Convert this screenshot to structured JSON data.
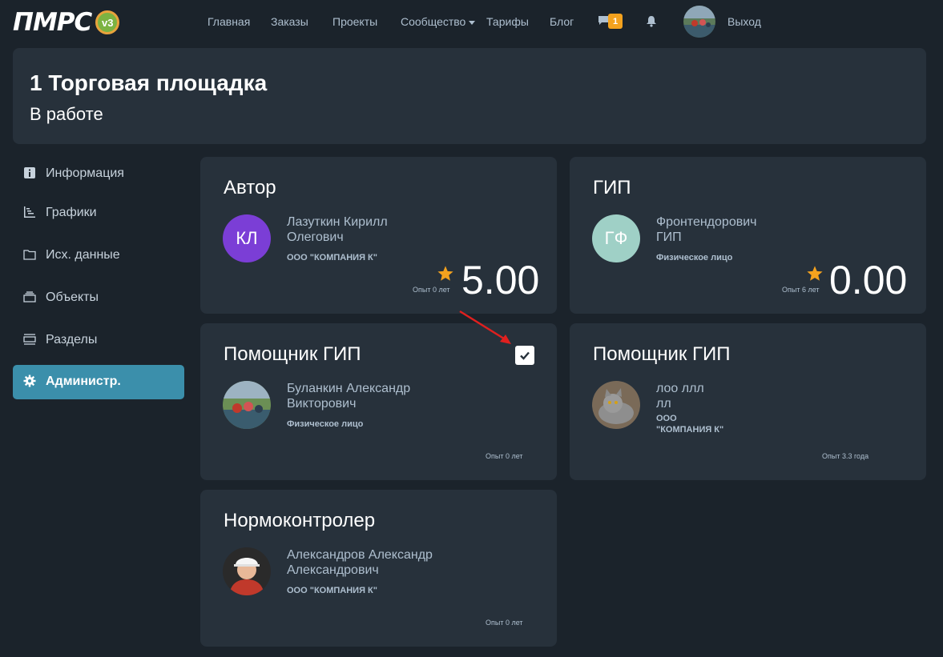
{
  "header": {
    "logo_text": "ПМРС",
    "logo_badge": "v3",
    "nav": [
      "Главная",
      "Заказы",
      "Проекты",
      "Сообщество",
      "Тарифы",
      "Блог"
    ],
    "messages_count": "1",
    "logout": "Выход"
  },
  "project": {
    "title": "1 Торговая площадка",
    "status": "В работе"
  },
  "sidebar": {
    "items": [
      {
        "label": "Информация",
        "icon": "info-icon"
      },
      {
        "label": "Графики",
        "icon": "gantt-icon"
      },
      {
        "label": "Исх. данные",
        "icon": "folder-icon"
      },
      {
        "label": "Объекты",
        "icon": "stack-icon"
      },
      {
        "label": "Разделы",
        "icon": "sections-icon"
      },
      {
        "label": "Администр.",
        "icon": "gear-icon",
        "active": true
      }
    ]
  },
  "cards": [
    {
      "role": "Автор",
      "initials": "КЛ",
      "name_line1": "Лазуткин Кирилл",
      "name_line2": "Олегович",
      "org": "ООО \"КОМПАНИЯ К\"",
      "experience": "Опыт 0 лет",
      "rating": "5.00",
      "avatar_color": "#7b3ed6"
    },
    {
      "role": "ГИП",
      "initials": "ГФ",
      "name_line1": "Фронтендорович",
      "name_line2": "ГИП",
      "org": "Физическое лицо",
      "experience": "Опыт 6 лет",
      "rating": "0.00",
      "avatar_color": "#9fd0c6"
    },
    {
      "role": "Помощник ГИП",
      "name_line1": "Буланкин Александр",
      "name_line2": "Викторович",
      "org": "Физическое лицо",
      "experience": "Опыт 0 лет",
      "checked": true
    },
    {
      "role": "Помощник ГИП",
      "name_line1": "лоо ллл",
      "name_line2": "лл",
      "org_line1": "ООО",
      "org_line2": "\"КОМПАНИЯ К\"",
      "experience": "Опыт 3.3 года"
    },
    {
      "role": "Нормоконтролер",
      "name_line1": "Александров Александр",
      "name_line2": "Александрович",
      "org": "ООО \"КОМПАНИЯ К\"",
      "experience": "Опыт 0 лет"
    }
  ],
  "colors": {
    "background": "#1b232b",
    "panel": "#27313b",
    "accent": "#3b8fab",
    "star": "#f4a21e",
    "muted_text": "#aebfcf"
  }
}
